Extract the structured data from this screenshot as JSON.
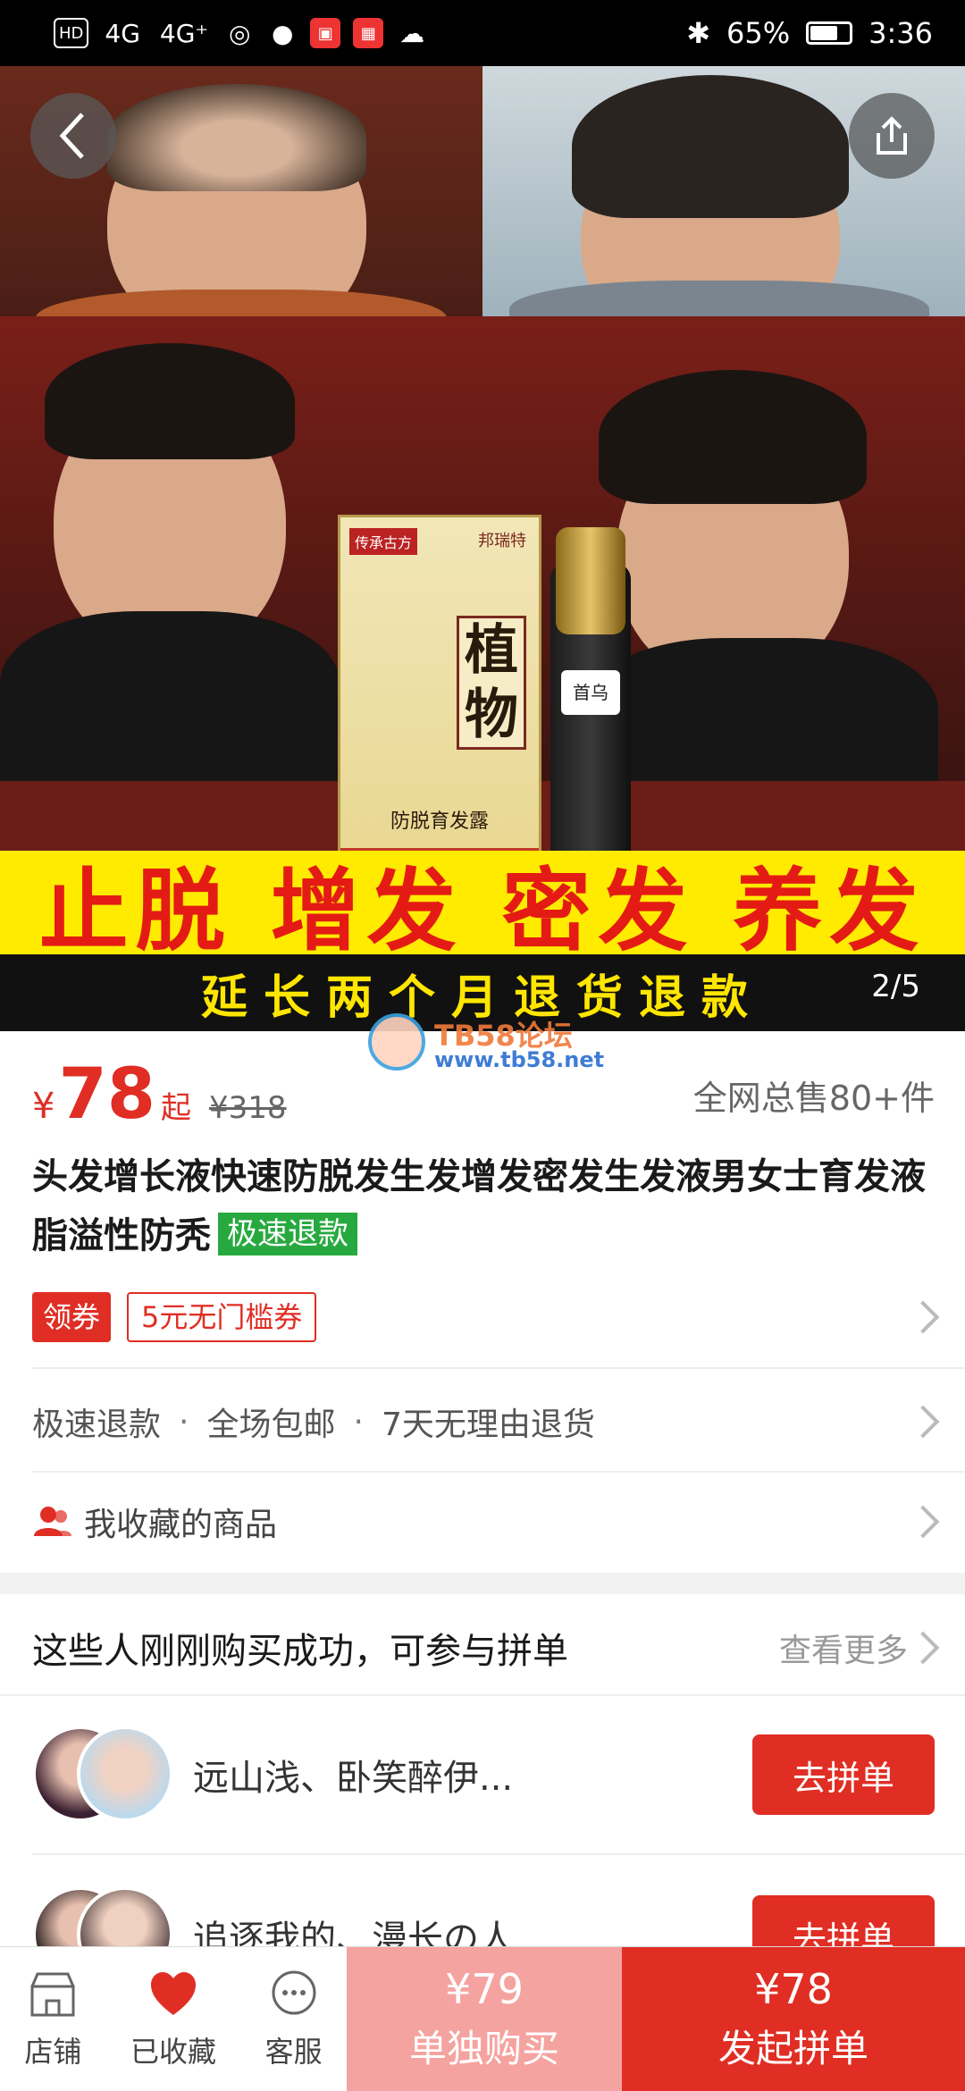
{
  "status_bar": {
    "icons": [
      "hd-icon",
      "signal-4g-icon",
      "signal-4g-plus-icon",
      "hotspot-icon",
      "message-icon",
      "app-notification-icon",
      "qr-app-icon",
      "cloud-icon"
    ],
    "network_1": "4G",
    "network_2": "4G⁺",
    "bluetooth_icon": "bluetooth-icon",
    "battery_percent": "65%",
    "battery_level": 0.65,
    "time": "3:36"
  },
  "gallery": {
    "banner_main": "止脱 增发 密发 养发",
    "banner_sub": "延长两个月退货退款",
    "box_brand": "邦瑞特",
    "box_tag": "传承古方",
    "box_name": "植物",
    "box_sub": "防脱育发露",
    "bottle_label": "首乌",
    "page_indicator": "2/5"
  },
  "watermark": {
    "line1": "TB58论坛",
    "line2": "www.tb58.net"
  },
  "product": {
    "currency": "¥",
    "price": "78",
    "price_suffix": "起",
    "original_price": "¥318",
    "sold_text": "全网总售80+件",
    "title": "头发增长液快速防脱发生发增发密发生发液男女士育发液脂溢性防秃",
    "title_badge": "极速退款"
  },
  "coupon": {
    "tag": "领券",
    "item": "5元无门槛券"
  },
  "services": [
    "极速退款",
    "全场包邮",
    "7天无理由退货"
  ],
  "services_separator": "·",
  "favorites": {
    "label": "我收藏的商品"
  },
  "group_buy": {
    "heading": "这些人刚刚购买成功，可参与拼单",
    "more": "查看更多",
    "rows": [
      {
        "names": "远山浅、卧笑醉伊...",
        "button": "去拼单"
      },
      {
        "names": "追逐我的、漫长の人",
        "button": "去拼单"
      }
    ]
  },
  "bottom_bar": {
    "tabs": [
      {
        "label": "店铺",
        "icon": "store-icon"
      },
      {
        "label": "已收藏",
        "icon": "heart-icon"
      },
      {
        "label": "客服",
        "icon": "chat-icon"
      }
    ],
    "single_price": "¥79",
    "single_label": "单独购买",
    "group_price": "¥78",
    "group_label": "发起拼单"
  },
  "colors": {
    "accent": "#e02e24",
    "accent_light": "#f5a3a0",
    "badge_green": "#27a93f",
    "banner_yellow": "#ffeb00"
  }
}
